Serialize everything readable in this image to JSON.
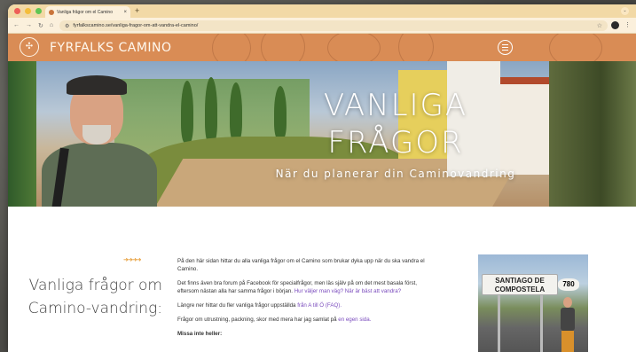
{
  "browser": {
    "tab_title": "Vanliga frågor om el Camino",
    "tab_close": "×",
    "new_tab": "+",
    "url": "fyrfalkscamino.se/vanliga-fragor-om-att-vandra-el-camino/",
    "nav_back": "←",
    "nav_forward": "→",
    "nav_reload": "↻",
    "nav_home": "⌂"
  },
  "site": {
    "name": "FYRFALKS CAMINO"
  },
  "hero": {
    "title_line1": "VANLIGA",
    "title_line2": "FRÅGOR",
    "subtitle": "När du planerar din Caminovandring"
  },
  "content": {
    "side_heading": "Vanliga frågor om Camino-vandring:",
    "arrows": "➜➜➜➜",
    "paragraphs": {
      "p1": "På den här sidan hittar du alla vanliga frågor om el Camino som brukar dyka upp när du ska vandra el Camino.",
      "p2_text": "Det finns även bra forum på Facebook för specialfrågor, men läs själv på om det mest basala först, eftersom nästan alla har samma frågor i början. ",
      "p2_link": "Hur väljer man väg? När är bäst att vandra?",
      "p3_text": "Längre ner hittar du fler vanliga frågor uppställda ",
      "p3_link": "från A till Ö (FAQ).",
      "p4_text": "Frågor om utrustning, packning, skor med mera har jag samlat på ",
      "p4_link": "en egen sida.",
      "p5": "Missa inte heller:"
    },
    "photo_sign_line1": "SANTIAGO DE",
    "photo_sign_line2": "COMPOSTELA",
    "photo_sign_number": "780"
  }
}
